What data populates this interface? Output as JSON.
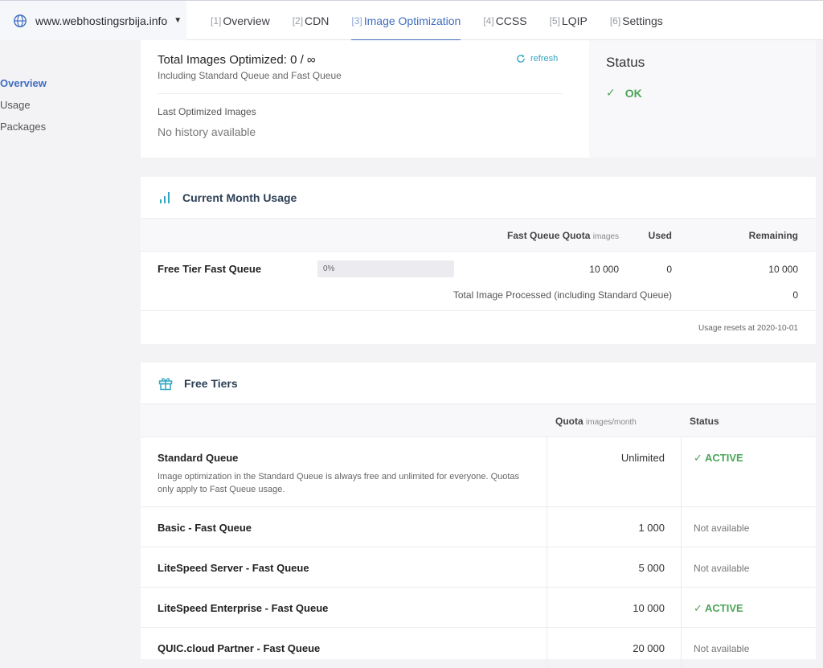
{
  "header": {
    "domain": "www.webhostingsrbija.info",
    "tabs": [
      {
        "num": "[1]",
        "label": "Overview"
      },
      {
        "num": "[2]",
        "label": "CDN"
      },
      {
        "num": "[3]",
        "label": "Image Optimization"
      },
      {
        "num": "[4]",
        "label": "CCSS"
      },
      {
        "num": "[5]",
        "label": "LQIP"
      },
      {
        "num": "[6]",
        "label": "Settings"
      }
    ],
    "active_tab": 2
  },
  "sidebar": {
    "items": [
      {
        "label": "Overview"
      },
      {
        "label": "Usage"
      },
      {
        "label": "Packages"
      }
    ]
  },
  "summary": {
    "title": "Total Images Optimized: 0 / ∞",
    "subtitle": "Including Standard Queue and Fast Queue",
    "refresh_label": "refresh",
    "last_label": "Last Optimized Images",
    "no_history": "No history available",
    "status_title": "Status",
    "status_value": "OK"
  },
  "usage": {
    "title": "Current Month Usage",
    "headers": {
      "quota": "Fast Queue Quota",
      "quota_unit": "images",
      "used": "Used",
      "remaining": "Remaining"
    },
    "row": {
      "label": "Free Tier Fast Queue",
      "progress": 0,
      "progress_label": "0%",
      "quota": "10 000",
      "used": "0",
      "remaining": "10 000"
    },
    "total_label": "Total Image Processed (including Standard Queue)",
    "total_value": "0",
    "reset": "Usage resets at 2020-10-01"
  },
  "tiers": {
    "title": "Free Tiers",
    "headers": {
      "quota": "Quota",
      "quota_unit": "images/month",
      "status": "Status"
    },
    "rows": [
      {
        "name": "Standard Queue",
        "desc": "Image optimization in the Standard Queue is always free and unlimited for everyone. Quotas only apply to Fast Queue usage.",
        "quota": "Unlimited",
        "status": "✓ ACTIVE"
      },
      {
        "name": "Basic - Fast Queue",
        "desc": "",
        "quota": "1 000",
        "status": "Not available"
      },
      {
        "name": "LiteSpeed Server - Fast Queue",
        "desc": "",
        "quota": "5 000",
        "status": "Not available"
      },
      {
        "name": "LiteSpeed Enterprise - Fast Queue",
        "desc": "",
        "quota": "10 000",
        "status": "✓ ACTIVE"
      },
      {
        "name": "QUIC.cloud Partner - Fast Queue",
        "desc": "",
        "quota": "20 000",
        "status": "Not available"
      }
    ]
  },
  "colors": {
    "accent": "#3e6dbf",
    "success": "#4aa557",
    "link": "#35a6c2"
  }
}
